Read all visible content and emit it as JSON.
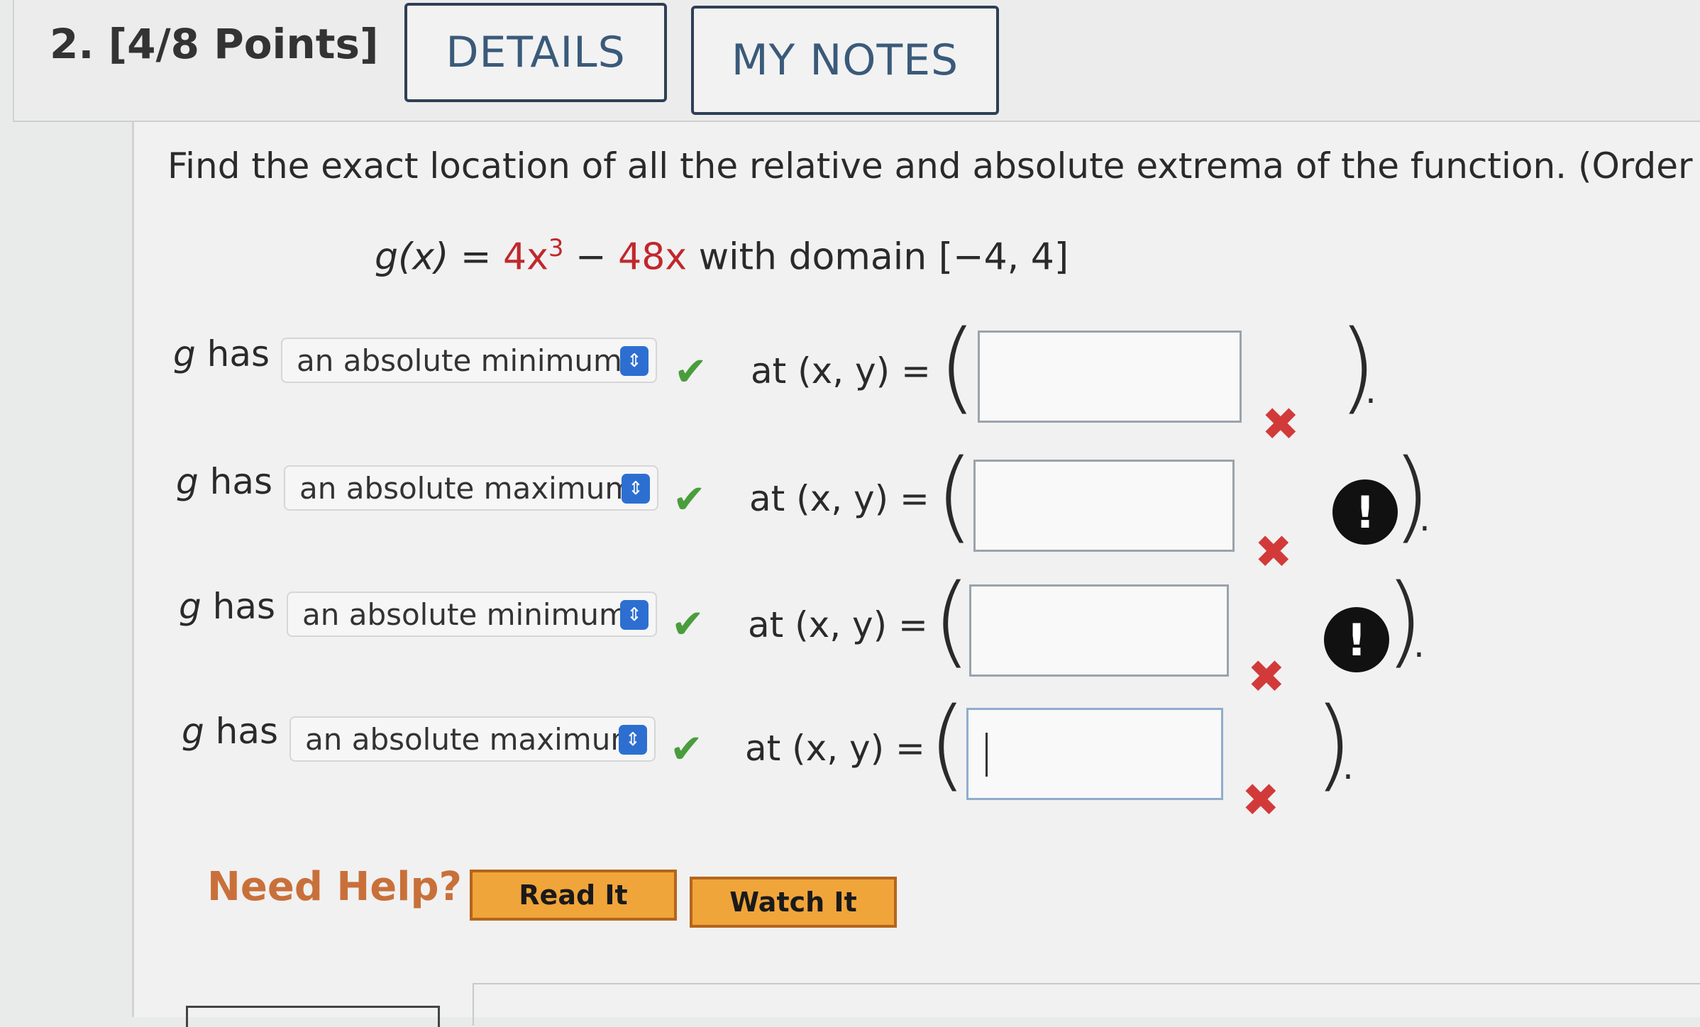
{
  "question": {
    "number": "2.",
    "points": "[4/8 Points]",
    "buttons": {
      "details": "DETAILS",
      "my_notes": "MY NOTES"
    }
  },
  "prompt": "Find the exact location of all the relative and absolute extrema of the function. (Order y",
  "function": {
    "lhs": "g(x) = ",
    "term1_coef": "4x",
    "term1_exp": "3",
    "minus": " − ",
    "term2": "48x",
    "domain_text": " with domain [−4, 4]"
  },
  "rows": [
    {
      "g_has": "g",
      "has": " has",
      "selected": "an absolute minimum",
      "at_label": "at (x, y) =",
      "value": "",
      "status": "incorrect",
      "alert": false
    },
    {
      "g_has": "g",
      "has": " has",
      "selected": "an absolute maximum",
      "at_label": "at (x, y) =",
      "value": "",
      "status": "incorrect",
      "alert": true
    },
    {
      "g_has": "g",
      "has": " has",
      "selected": "an absolute minimum",
      "at_label": "at (x, y) =",
      "value": "",
      "status": "incorrect",
      "alert": true
    },
    {
      "g_has": "g",
      "has": " has",
      "selected": "an absolute maximum",
      "at_label": "at (x, y) =",
      "value": "",
      "status": "incorrect",
      "alert": false
    }
  ],
  "symbols": {
    "check": "✔",
    "cross": "✖",
    "alert": "!",
    "open_paren": "(",
    "close_paren": ")",
    "period": ".",
    "select_arrow": "⇕"
  },
  "help": {
    "label": "Need Help?",
    "read_it": "Read It",
    "watch_it": "Watch It"
  },
  "colors": {
    "accent_blue": "#2d6fd1",
    "check_green": "#4a9d3d",
    "error_red": "#d23a3a",
    "help_orange": "#f0a53a",
    "need_help_text": "#c9703a"
  }
}
